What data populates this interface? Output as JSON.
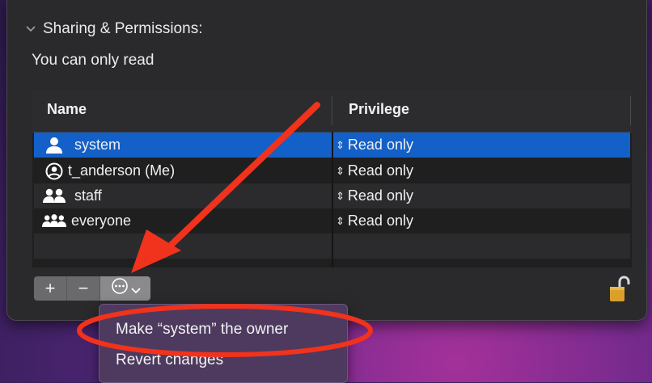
{
  "section": {
    "title": "Sharing & Permissions:",
    "note": "You can only read"
  },
  "table": {
    "columns": [
      "Name",
      "Privilege"
    ],
    "rows": [
      {
        "name": "system",
        "privilege": "Read only",
        "icon": "single-user-icon"
      },
      {
        "name": "t_anderson (Me)",
        "privilege": "Read only",
        "icon": "user-circle-icon"
      },
      {
        "name": "staff",
        "privilege": "Read only",
        "icon": "two-users-icon"
      },
      {
        "name": "everyone",
        "privilege": "Read only",
        "icon": "group-users-icon"
      }
    ],
    "selected_row": 0
  },
  "toolbar": {
    "add_label": "+",
    "remove_label": "−",
    "action_icon": "ellipsis-circle-icon"
  },
  "menu": {
    "items": [
      "Make “system” the owner",
      "Revert changes"
    ]
  },
  "annotation": {
    "color": "#f1321c"
  },
  "colors": {
    "selection": "#1360c8",
    "panel": "#2a2a2c"
  }
}
